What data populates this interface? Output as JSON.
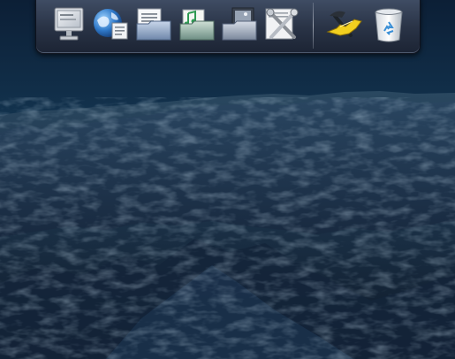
{
  "desktop": {
    "sky_colors": [
      "#0f2742",
      "#1c4a6b",
      "#2b6a86"
    ],
    "mountain_colors": [
      "#1c2d45",
      "#233a54",
      "#2e4a63"
    ]
  },
  "dock": {
    "items": [
      {
        "icon": "computer-icon"
      },
      {
        "icon": "network-globe-icon"
      },
      {
        "icon": "documents-folder-icon"
      },
      {
        "icon": "music-folder-icon"
      },
      {
        "icon": "pictures-folder-icon"
      },
      {
        "icon": "utilities-tools-icon"
      },
      {
        "icon": "developer-tools-hammer-icon"
      },
      {
        "icon": "trash-icon"
      }
    ]
  }
}
